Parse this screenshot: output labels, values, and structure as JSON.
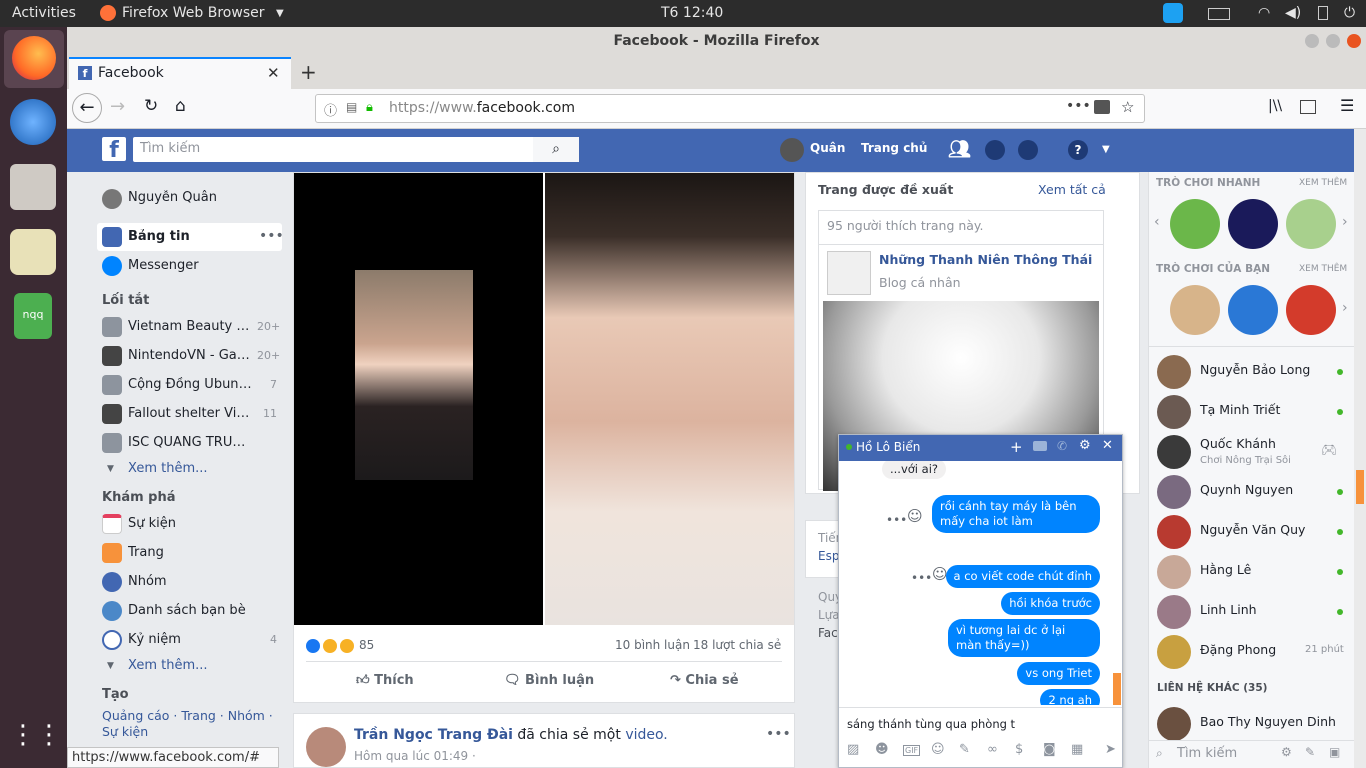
{
  "system": {
    "activities": "Activities",
    "app_menu": "Firefox Web Browser",
    "clock": "T6 12:40"
  },
  "browser": {
    "window_title": "Facebook - Mozilla Firefox",
    "tab_title": "Facebook",
    "url_prefix": "https://www.",
    "url_domain": "facebook.com",
    "status_url": "https://www.facebook.com/#"
  },
  "fb": {
    "search_placeholder": "Tìm kiếm",
    "user_short": "Quân",
    "home": "Trang chủ"
  },
  "left": {
    "profile": "Nguyễn Quân",
    "newsfeed": "Bảng tin",
    "messenger": "Messenger",
    "shortcuts_head": "Lối tắt",
    "shortcuts": [
      {
        "label": "Vietnam Beauty & ...",
        "count": "20+"
      },
      {
        "label": "NintendoVN - Gam...",
        "count": "20+"
      },
      {
        "label": "Cộng Đồng Ubuntu ...",
        "count": "7"
      },
      {
        "label": "Fallout shelter Viet ...",
        "count": "11"
      },
      {
        "label": "ISC QUANG TRUN...",
        "count": ""
      }
    ],
    "see_more": "Xem thêm...",
    "explore_head": "Khám phá",
    "explore": [
      {
        "label": "Sự kiện",
        "count": ""
      },
      {
        "label": "Trang",
        "count": ""
      },
      {
        "label": "Nhóm",
        "count": ""
      },
      {
        "label": "Danh sách bạn bè",
        "count": ""
      },
      {
        "label": "Kỷ niệm",
        "count": "4"
      }
    ],
    "see_more2": "Xem thêm...",
    "create_head": "Tạo",
    "create_links": "Quảng cáo · Trang · Nhóm ·",
    "create_links2": "Sự kiện"
  },
  "post": {
    "reactions_count": "85",
    "comments": "10 bình luận",
    "shares": "18 lượt chia sẻ",
    "like": "Thích",
    "comment": "Bình luận",
    "share": "Chia sẻ"
  },
  "post2": {
    "author": "Trần Ngọc Trang Đài",
    "action": "đã chia sẻ một",
    "object": "video.",
    "time": "Hôm qua lúc 01:49 ·"
  },
  "suggested": {
    "title": "Trang được đề xuất",
    "see_all": "Xem tất cả",
    "likes": "95 người thích trang này.",
    "page_name": "Những Thanh Niên Thông Thái",
    "page_type": "Blog cá nhân",
    "peek1": "Tiếng",
    "peek2": "Esp",
    "peek3": "Quy",
    "peek4": "Lựa",
    "peek5": "Fac"
  },
  "chat": {
    "name": "Hồ Lô Biển",
    "incoming": "...với ai?",
    "messages": [
      "rồi cánh tay máy là bên mấy cha iot làm",
      "a co viết code chút đỉnh",
      "hồi khóa trước",
      "vì tương lai dc ở lại màn thấy=))",
      "vs ong Triet",
      "2 ng ah"
    ],
    "draft": "sáng thánh tùng qua phòng t"
  },
  "sidebar": {
    "quick_games": "TRÒ CHƠI NHANH",
    "see_more": "XEM THÊM",
    "your_games": "TRÒ CHƠI CỦA BẠN",
    "contacts": [
      {
        "name": "Nguyễn Bảo Long",
        "status": "online"
      },
      {
        "name": "Tạ Minh Triết",
        "status": "online"
      },
      {
        "name": "Quốc Khánh",
        "status": "game"
      },
      {
        "name": "Quynh Nguyen",
        "status": "online"
      },
      {
        "name": "Nguyễn Văn Quy",
        "status": "online"
      },
      {
        "name": "Hằng Lê",
        "status": "online"
      },
      {
        "name": "Linh Linh",
        "status": "online"
      },
      {
        "name": "Đặng Phong",
        "status": "21 phút"
      }
    ],
    "khanh_sub": "Chơi Nông Trại Sôi",
    "other_contacts": "LIÊN HỆ KHÁC (35)",
    "other1": "Bao Thy Nguyen Dinh",
    "search_placeholder": "Tìm kiếm"
  },
  "colors": {
    "fb_blue": "#4267b2",
    "messenger_blue": "#0084ff",
    "online": "#42b72a"
  }
}
